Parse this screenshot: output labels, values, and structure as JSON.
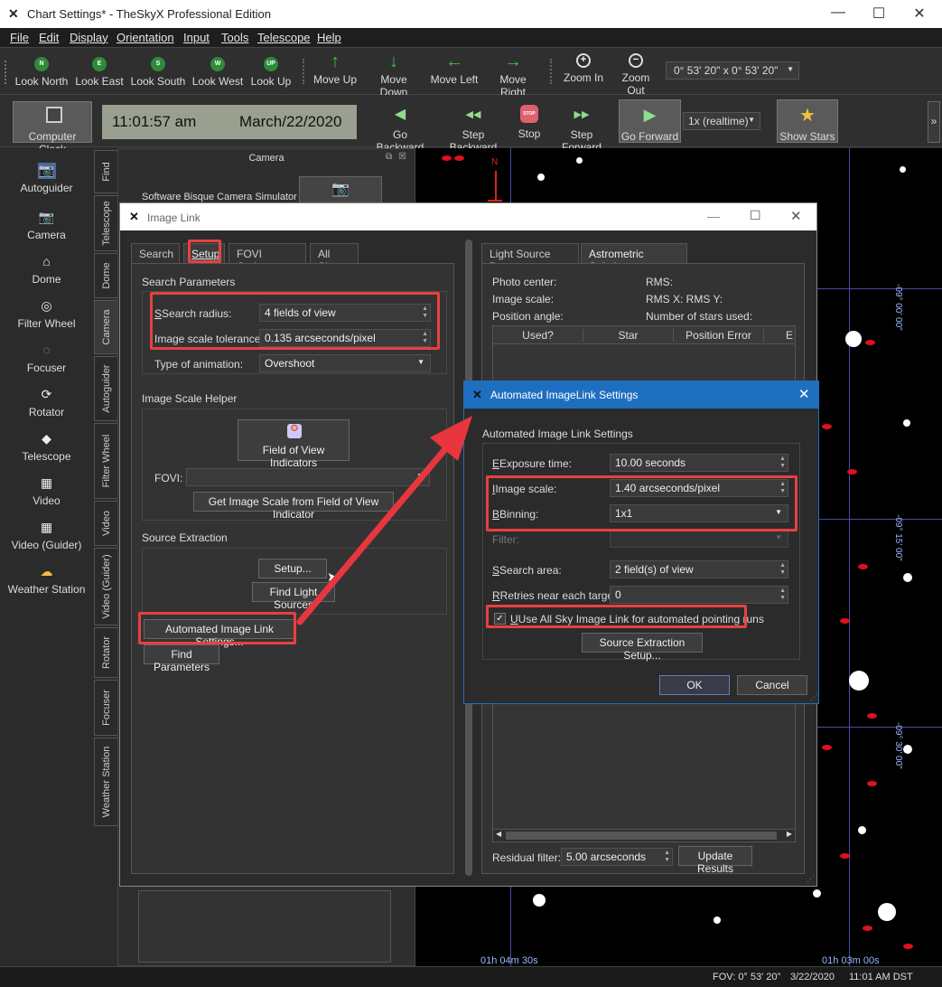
{
  "window": {
    "title": "Chart Settings* - TheSkyX Professional Edition",
    "minimize": "—",
    "maximize": "☐",
    "close": "✕"
  },
  "menu": [
    "File",
    "Edit",
    "Display",
    "Orientation",
    "Input",
    "Tools",
    "Telescope",
    "Help"
  ],
  "toolbar1": {
    "look": [
      {
        "icon": "N",
        "label": "Look North"
      },
      {
        "icon": "E",
        "label": "Look East"
      },
      {
        "icon": "S",
        "label": "Look South"
      },
      {
        "icon": "W",
        "label": "Look West"
      },
      {
        "icon": "UP",
        "label": "Look Up"
      }
    ],
    "move": [
      {
        "icon": "↑",
        "label": "Move Up"
      },
      {
        "icon": "↓",
        "label": "Move Down"
      },
      {
        "icon": "←",
        "label": "Move Left"
      },
      {
        "icon": "→",
        "label": "Move Right"
      }
    ],
    "zoom": [
      {
        "icon": "+",
        "label": "Zoom In"
      },
      {
        "icon": "−",
        "label": "Zoom Out"
      }
    ],
    "fov_value": "0° 53' 20\" x 0° 53' 20\""
  },
  "toolbar2": {
    "computer_clock": "Computer Clock",
    "time": "11:01:57 am",
    "date": "March/22/2020",
    "nav": [
      {
        "icon": "◀",
        "label": "Go Backward"
      },
      {
        "icon": "◀◀",
        "label": "Step Backward"
      },
      {
        "icon": "STOP",
        "label": "Stop"
      },
      {
        "icon": "▶▶",
        "label": "Step Forward"
      },
      {
        "icon": "▶",
        "label": "Go Forward"
      }
    ],
    "rate": "1x (realtime)",
    "show_stars": "Show Stars",
    "more": "»"
  },
  "left_panel": [
    {
      "icon": "📷",
      "label": "Autoguider"
    },
    {
      "icon": "📷",
      "label": "Camera"
    },
    {
      "icon": "⌂",
      "label": "Dome"
    },
    {
      "icon": "◎",
      "label": "Filter Wheel"
    },
    {
      "icon": "◌",
      "label": "Focuser"
    },
    {
      "icon": "⟳",
      "label": "Rotator"
    },
    {
      "icon": "◆",
      "label": "Telescope"
    },
    {
      "icon": "▦",
      "label": "Video"
    },
    {
      "icon": "▦",
      "label": "Video (Guider)"
    },
    {
      "icon": "☁",
      "label": "Weather Station"
    }
  ],
  "vertical_tabs": [
    "Find",
    "Telescope",
    "Dome",
    "Camera",
    "Autoguider",
    "Filter Wheel",
    "Video",
    "Video (Guider)",
    "Rotator",
    "Focuser",
    "Weather Station"
  ],
  "camera_panel": {
    "title": "Camera",
    "device": "Software Bisque Camera Simulator"
  },
  "sky": {
    "north": "N",
    "ra_left": "01h 04m 30s",
    "ra_right": "01h 03m 00s",
    "dec1": "-09° 00' 00\"",
    "dec2": "-09° 15' 00\"",
    "dec3": "-09° 30' 00\""
  },
  "status": {
    "fov": "FOV: 0° 53' 20\"",
    "date": "3/22/2020",
    "time": "11:01 AM DST"
  },
  "image_link": {
    "title": "Image Link",
    "tabs": [
      "Search",
      "Setup",
      "FOVI Options",
      "All Sky"
    ],
    "search_parameters": "Search Parameters",
    "search_radius_label": "Search radius:",
    "search_radius": "4 fields of view",
    "scale_tol_label": "Image scale tolerance:",
    "scale_tol": "0.135 arcseconds/pixel",
    "animation_label": "Type of animation:",
    "animation": "Overshoot",
    "helper_title": "Image Scale Helper",
    "fovi_button": "Field of View Indicators",
    "fovi_label": "FOVI:",
    "get_scale_button": "Get Image Scale from Field of View Indicator",
    "source_title": "Source Extraction",
    "setup_button": "Setup...",
    "find_light_button": "Find Light Sources",
    "auto_button": "Automated Image Link Settings...",
    "find_params_button": "Find Parameters",
    "right_tabs": [
      "Light Source Data",
      "Astrometric Solution"
    ],
    "photo_center": "Photo center:",
    "rms": "RMS:",
    "image_scale": "Image scale:",
    "rms_xy": "RMS X:  RMS Y:",
    "position_angle": "Position angle:",
    "num_stars": "Number of stars used:",
    "columns": [
      "Used?",
      "Star",
      "Position Error",
      "E"
    ],
    "residual_label": "Residual filter:",
    "residual": "5.00 arcseconds",
    "update_button": "Update Results"
  },
  "auto_dialog": {
    "title": "Automated ImageLink Settings",
    "group": "Automated Image Link Settings",
    "exposure_label": "Exposure time:",
    "exposure": "10.00 seconds",
    "scale_label": "Image scale:",
    "scale": "1.40 arcseconds/pixel",
    "binning_label": "Binning:",
    "binning": "1x1",
    "filter_label": "Filter:",
    "search_area_label": "Search area:",
    "search_area": "2 field(s) of view",
    "retries_label": "Retries near each target:",
    "retries": "0",
    "allsky_checkbox": "Use All Sky Image Link for automated pointing runs",
    "source_setup_button": "Source Extraction Setup...",
    "ok": "OK",
    "cancel": "Cancel"
  },
  "colors": {
    "highlight": "#e84040",
    "arrow": "#e8363e",
    "grid": "#4a4aa8",
    "dialog_title_active": "#1f6fc0"
  }
}
